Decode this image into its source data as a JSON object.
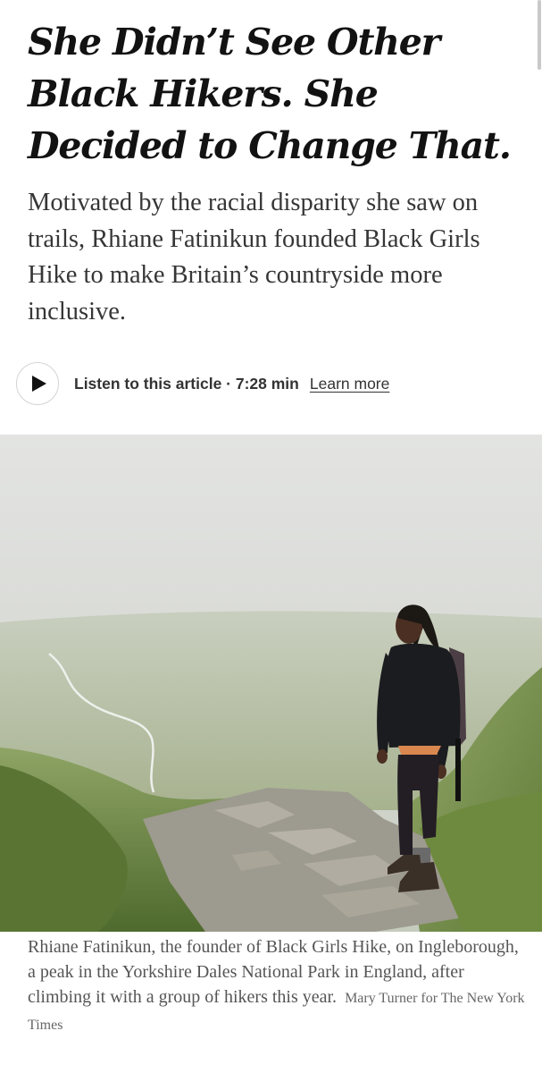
{
  "article": {
    "headline": "She Didn’t See Other Black Hikers. She Decided to Change That.",
    "summary": "Motivated by the racial disparity she saw on trails, Rhiane Fatinikun founded Black Girls Hike to make Britain’s countryside more inclusive."
  },
  "audio": {
    "play_icon": "play-icon",
    "listen_label": "Listen to this article · 7:28 min",
    "learn_more_label": "Learn more"
  },
  "photo": {
    "caption": "Rhiane Fatinikun, the founder of Black Girls Hike, on Ingleborough, a peak in the Yorkshire Dales National Park in England, after climbing it with a group of hikers this year.",
    "credit": "Mary Turner for The New York Times"
  },
  "colors": {
    "headline": "#121212",
    "summary": "#363636",
    "caption": "#555555",
    "sky": "#dedfdd",
    "grass": "#7d9155"
  }
}
